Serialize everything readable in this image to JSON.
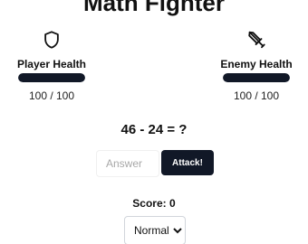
{
  "game": {
    "title": "Math Fighter"
  },
  "player": {
    "label": "Player Health",
    "health_text": "100 / 100",
    "health_fraction": 1.0,
    "icon": "shield-icon"
  },
  "enemy": {
    "label": "Enemy Health",
    "health_text": "100 / 100",
    "health_fraction": 1.0,
    "icon": "sword-icon"
  },
  "question": {
    "equation": "46 - 24 = ?"
  },
  "answer": {
    "value": "",
    "placeholder": "Answer",
    "attack_label": "Attack!"
  },
  "score": {
    "label": "Score:",
    "value": "0"
  },
  "difficulty": {
    "selected": "Normal",
    "options": [
      "Normal"
    ]
  },
  "colors": {
    "bar_fill": "#111827",
    "button_bg": "#111827",
    "button_text": "#ffffff"
  }
}
